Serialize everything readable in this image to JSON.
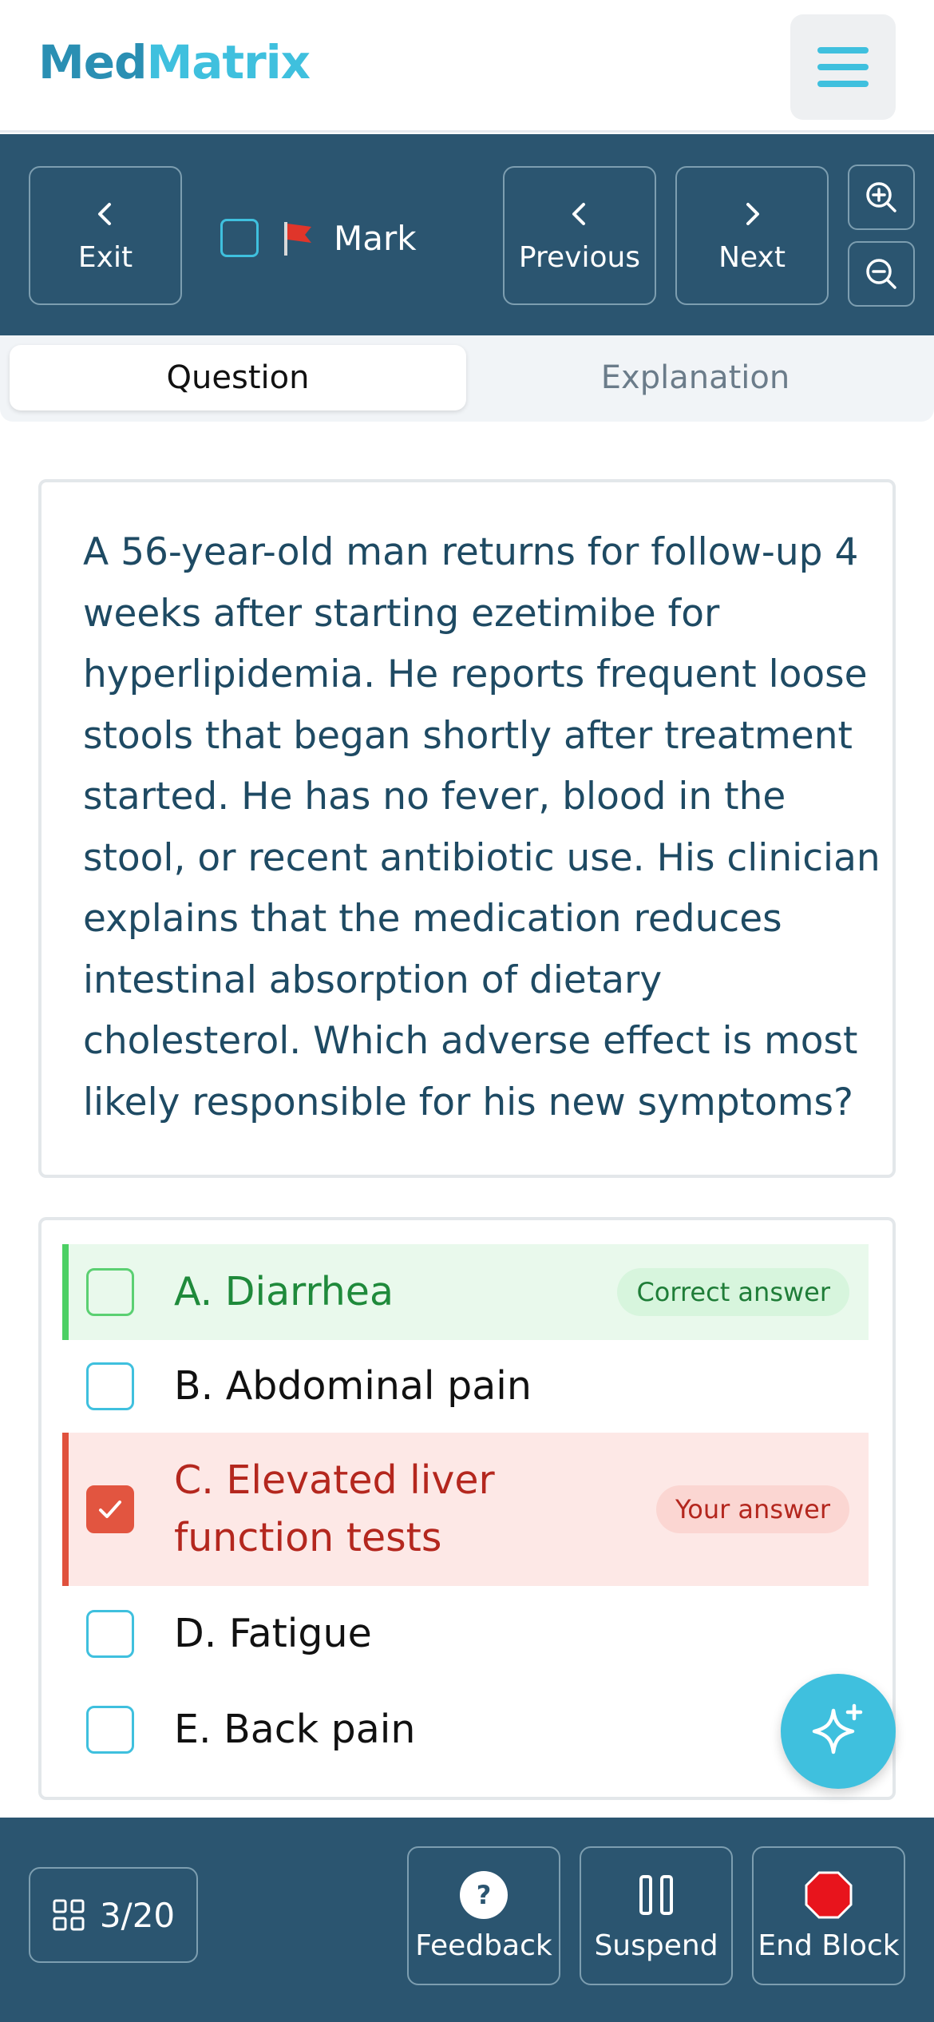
{
  "app": {
    "logo_part1": "Med",
    "logo_part2": "Matrix",
    "menu_icon": "hamburger-menu-icon",
    "colors": {
      "primary_dark": "#2b5570",
      "accent": "#3fc0de",
      "logo_dark": "#2a8fb3",
      "correct": "#4cd064",
      "incorrect": "#e0513d"
    }
  },
  "toolbar": {
    "exit_label": "Exit",
    "mark_label": "Mark",
    "mark_checked": false,
    "previous_label": "Previous",
    "next_label": "Next",
    "zoom_in_icon": "zoom-in-icon",
    "zoom_out_icon": "zoom-out-icon"
  },
  "tabs": [
    {
      "label": "Question",
      "active": true
    },
    {
      "label": "Explanation",
      "active": false
    }
  ],
  "question": {
    "text": "A 56-year-old man returns for follow-up 4 weeks after starting ezetimibe for hyperlipidemia. He reports frequent loose stools that began shortly after treatment started. He has no fever, blood in the stool, or recent antibiotic use. His clinician explains that the medication reduces intestinal absorption of dietary cholesterol. Which adverse effect is most likely responsible for his new symptoms?"
  },
  "options": [
    {
      "label": "A. Diarrhea",
      "state": "correct",
      "badge": "Correct answer"
    },
    {
      "label": "B. Abdominal pain",
      "state": "none"
    },
    {
      "label": "C. Elevated liver function tests",
      "state": "selected-wrong",
      "badge": "Your answer"
    },
    {
      "label": "D. Fatigue",
      "state": "none"
    },
    {
      "label": "E. Back pain",
      "state": "none"
    }
  ],
  "footer": {
    "counter": "3/20",
    "feedback_label": "Feedback",
    "suspend_label": "Suspend",
    "end_block_label": "End Block"
  }
}
